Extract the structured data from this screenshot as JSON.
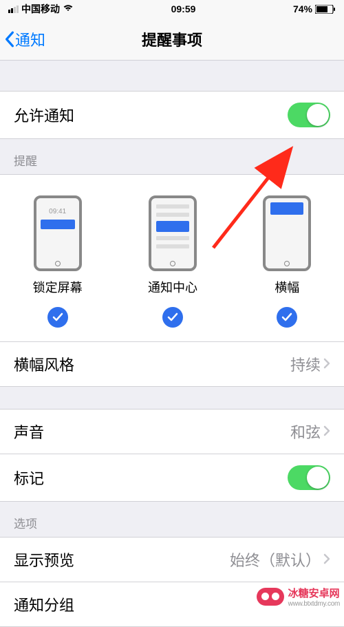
{
  "statusbar": {
    "carrier": "中国移动",
    "time": "09:59",
    "battery_pct": "74%"
  },
  "nav": {
    "back_label": "通知",
    "title": "提醒事项"
  },
  "allow_notifications": {
    "label": "允许通知",
    "on": true
  },
  "alerts_header": "提醒",
  "alert_types": [
    {
      "label": "锁定屏幕",
      "device_time": "09:41",
      "checked": true
    },
    {
      "label": "通知中心",
      "checked": true
    },
    {
      "label": "横幅",
      "checked": true
    }
  ],
  "banner_style": {
    "label": "横幅风格",
    "value": "持续"
  },
  "sound": {
    "label": "声音",
    "value": "和弦"
  },
  "badge": {
    "label": "标记",
    "on": true
  },
  "options_header": "选项",
  "show_previews": {
    "label": "显示预览",
    "value": "始终（默认）"
  },
  "grouping": {
    "label": "通知分组"
  },
  "watermark": {
    "text": "冰糖安卓网",
    "url": "www.btxtdmy.com"
  }
}
